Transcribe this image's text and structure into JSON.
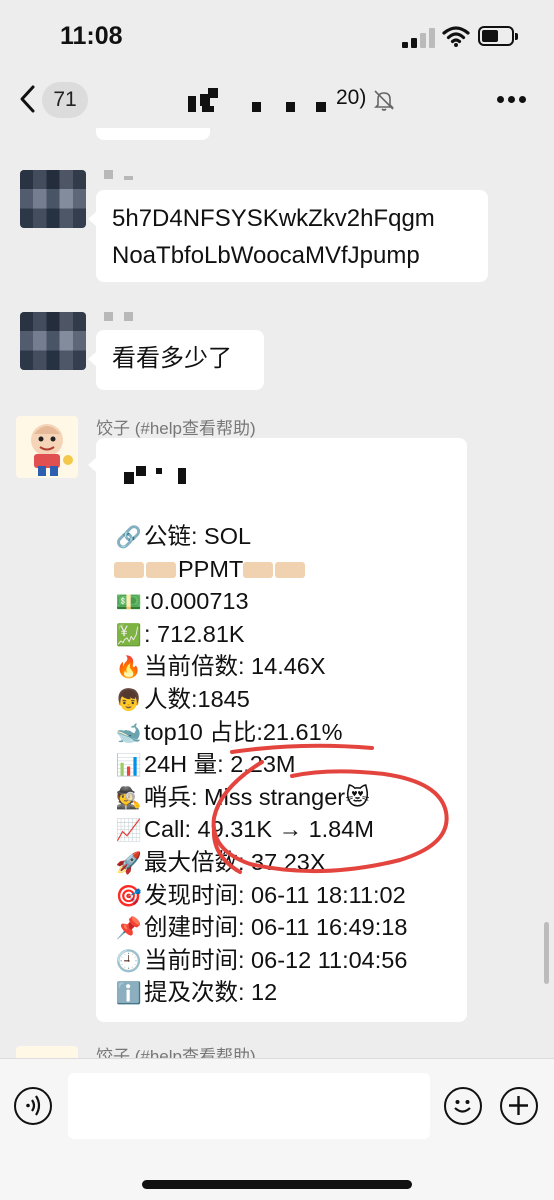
{
  "status_bar": {
    "time": "11:08",
    "icons": [
      "signal-icon",
      "wifi-icon",
      "battery-icon"
    ]
  },
  "nav": {
    "back_icon": "chevron-left-icon",
    "unread_count": "71",
    "title_suffix": "20)",
    "mute_icon": "bell-slash-icon",
    "more_icon": "ellipsis-icon"
  },
  "messages": [
    {
      "sender": "user-1",
      "text_lines": [
        "5h7D4NFSYSKwkZkv2hFqgm",
        "NoaTbfoLbWoocaMVfJpump"
      ]
    },
    {
      "sender": "user-1",
      "text_lines": [
        "看看多少了"
      ]
    },
    {
      "sender": "bot",
      "name": "饺子 (#help查看帮助)",
      "card": {
        "lines": [
          {
            "emoji": "🔗",
            "text": "公链: SOL"
          },
          {
            "emoji": "",
            "text": "PPMT",
            "decorated": true
          },
          {
            "emoji": "💵",
            "text": ":0.000713"
          },
          {
            "emoji": "💹",
            "text": ": 712.81K"
          },
          {
            "emoji": "🔥",
            "text": "当前倍数: 14.46X"
          },
          {
            "emoji": "👦",
            "text": "人数:1845"
          },
          {
            "emoji": "🐋",
            "text": "top10 占比:21.61%"
          },
          {
            "emoji": "📊",
            "text": "24H 量: 2.23M"
          },
          {
            "emoji": "🕵",
            "text": "哨兵: Miss stranger😻"
          },
          {
            "emoji": "📈",
            "text": "Call: 49.31K → 1.84M"
          },
          {
            "emoji": "🚀",
            "text": "最大倍数: 37.23X"
          },
          {
            "emoji": "🎯",
            "text": "发现时间: 06-11 18:11:02"
          },
          {
            "emoji": "📌",
            "text": "创建时间: 06-11 16:49:18"
          },
          {
            "emoji": "🕘",
            "text": "当前时间: 06-12 11:04:56"
          },
          {
            "emoji": "ℹ️",
            "text": "提及次数: 12"
          }
        ]
      }
    },
    {
      "sender": "bot",
      "name": "饺子 (#help查看帮助)"
    }
  ],
  "input_bar": {
    "voice_icon": "voice-icon",
    "placeholder": "",
    "emoji_icon": "smile-icon",
    "add_icon": "plus-icon"
  },
  "colors": {
    "background": "#ededed",
    "bubble": "#ffffff",
    "annotation_ink": "#e3453e"
  }
}
